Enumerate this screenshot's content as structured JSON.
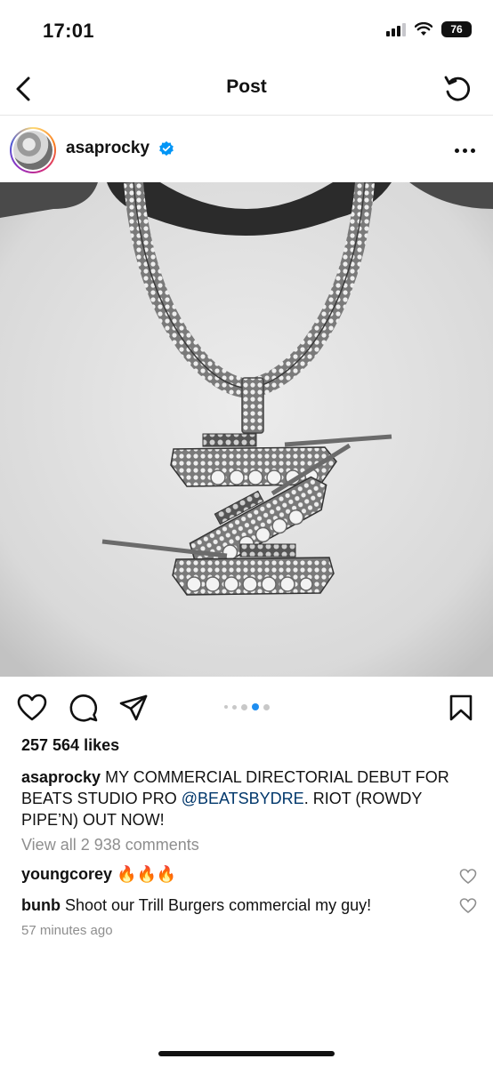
{
  "status_bar": {
    "time": "17:01",
    "battery": "76",
    "icons": [
      "cellular-signal-icon",
      "wifi-icon",
      "battery-icon"
    ]
  },
  "nav": {
    "title": "Post",
    "back_icon": "chevron-left-icon",
    "refresh_icon": "refresh-icon"
  },
  "post": {
    "username": "asaprocky",
    "verified": true,
    "image_description_icon": "photo",
    "carousel": {
      "count": 5,
      "active_index": 3
    },
    "likes": "257 564 likes",
    "caption": {
      "user": "asaprocky",
      "text_before": "MY COMMERCIAL DIRECTORIAL DEBUT FOR BEATS STUDIO PRO",
      "mention": "@BEATSBYDRE",
      "text_after": ". RIOT (ROWDY PIPE’N) OUT NOW!"
    },
    "view_comments": "View all 2 938 comments",
    "comments": [
      {
        "user": "youngcorey",
        "text": "🔥🔥🔥"
      },
      {
        "user": "bunb",
        "text": "Shoot our Trill Burgers commercial my guy!"
      }
    ],
    "timestamp": "57 minutes ago"
  },
  "colors": {
    "accent": "#1f8ef0",
    "mention": "#00376b",
    "muted": "#8e8e8e",
    "verified": "#0095f6"
  }
}
